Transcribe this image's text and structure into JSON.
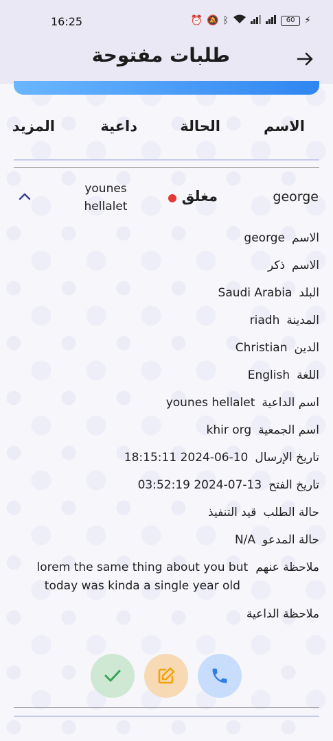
{
  "status_bar": {
    "time": "16:25",
    "battery": "60",
    "icons": [
      "alarm-icon",
      "mute-icon",
      "bluetooth-icon",
      "wifi-icon",
      "signal-icon",
      "signal-icon",
      "battery-icon",
      "charging-icon"
    ]
  },
  "appbar": {
    "title": "طلبات مفتوحة",
    "back_icon": "arrow-right-icon"
  },
  "colors": {
    "accent_gradient_start": "#6ab6ff",
    "accent_gradient_end": "#2f86f0",
    "status_closed_dot": "#e53935",
    "approve": "#cfe8d3",
    "edit": "#f7d9b4",
    "call": "#c7ddfb"
  },
  "table": {
    "headers": {
      "name": "الاسم",
      "status": "الحالة",
      "daiya": "داعية",
      "more": "المزيد"
    },
    "row": {
      "name": "george",
      "status": "مغلق",
      "daiya": "younes hellalet",
      "expanded": true
    }
  },
  "details": [
    {
      "label": "الاسم",
      "value": "george"
    },
    {
      "label": "الاسم",
      "value": "ذكر"
    },
    {
      "label": "البلد",
      "value": "Saudi Arabia"
    },
    {
      "label": "المدينة",
      "value": "riadh"
    },
    {
      "label": "الدين",
      "value": "Christian"
    },
    {
      "label": "اللغة",
      "value": "English"
    },
    {
      "label": "اسم الداعية",
      "value": "younes hellalet"
    },
    {
      "label": "اسم الجمعية",
      "value": "khir org"
    },
    {
      "label": "تاريخ الإرسال",
      "value": "2024-06-10 18:15:11"
    },
    {
      "label": "تاريخ الفتح",
      "value": "2024-07-13 03:52:19"
    },
    {
      "label": "حالة الطلب",
      "value": "قيد التنفيذ"
    },
    {
      "label": "حالة المدعو",
      "value": "N/A"
    },
    {
      "label": "ملاحظة عنهم",
      "value": "lorem the same thing about you but today was kinda a single year old"
    },
    {
      "label": "ملاحظة الداعية",
      "value": ""
    }
  ],
  "actions": [
    {
      "name": "approve-button",
      "icon": "check-icon"
    },
    {
      "name": "edit-button",
      "icon": "edit-icon"
    },
    {
      "name": "call-button",
      "icon": "phone-icon"
    }
  ]
}
